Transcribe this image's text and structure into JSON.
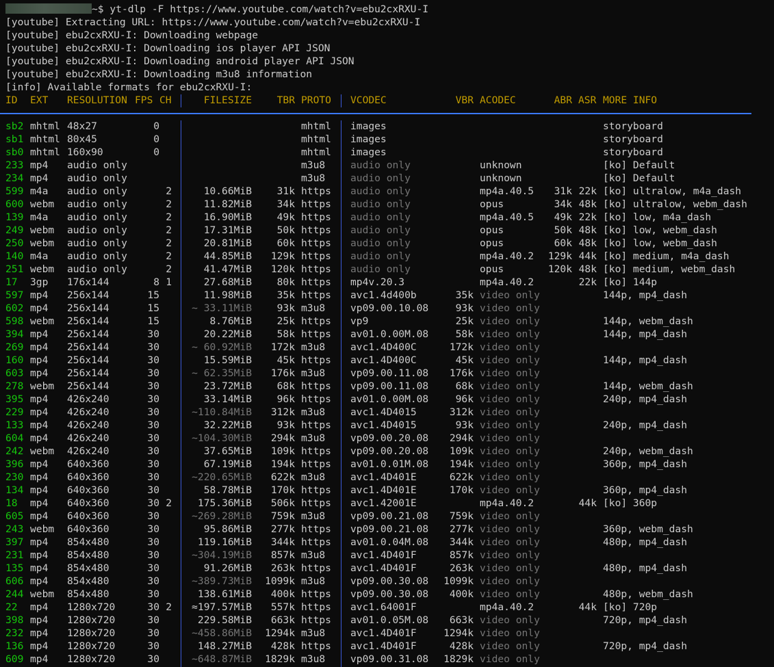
{
  "prompt": {
    "symbol": "~$",
    "command": "yt-dlp -F https://www.youtube.com/watch?v=ebu2cxRXU-I"
  },
  "log": [
    "[youtube] Extracting URL: https://www.youtube.com/watch?v=ebu2cxRXU-I",
    "[youtube] ebu2cxRXU-I: Downloading webpage",
    "[youtube] ebu2cxRXU-I: Downloading ios player API JSON",
    "[youtube] ebu2cxRXU-I: Downloading android player API JSON",
    "[youtube] ebu2cxRXU-I: Downloading m3u8 information",
    "[info] Available formats for ebu2cxRXU-I:"
  ],
  "headers": {
    "id": "ID",
    "ext": "EXT",
    "res": "RESOLUTION",
    "fps": "FPS",
    "ch": "CH",
    "size": "FILESIZE",
    "tbr": "TBR",
    "proto": "PROTO",
    "vcodec": "VCODEC",
    "vbr": "VBR",
    "acodec": "ACODEC",
    "abr": "ABR",
    "asr": "ASR",
    "info": "MORE INFO"
  },
  "colors": {
    "background": "#0c0c0c",
    "text": "#cccccc",
    "header": "#c19c00",
    "id": "#16c60c",
    "dim": "#767676",
    "separator": "#3b5bdb"
  },
  "rows": [
    [
      "sb2",
      "mhtml",
      "48x27",
      "0",
      "",
      "",
      "",
      "mhtml",
      "images",
      "",
      "",
      "",
      "",
      "storyboard"
    ],
    [
      "sb1",
      "mhtml",
      "80x45",
      "0",
      "",
      "",
      "",
      "mhtml",
      "images",
      "",
      "",
      "",
      "",
      "storyboard"
    ],
    [
      "sb0",
      "mhtml",
      "160x90",
      "0",
      "",
      "",
      "",
      "mhtml",
      "images",
      "",
      "",
      "",
      "",
      "storyboard"
    ],
    [
      "233",
      "mp4",
      "audio only",
      "",
      "",
      "",
      "",
      "m3u8",
      "audio only",
      "",
      "unknown",
      "",
      "",
      "[ko] Default"
    ],
    [
      "234",
      "mp4",
      "audio only",
      "",
      "",
      "",
      "",
      "m3u8",
      "audio only",
      "",
      "unknown",
      "",
      "",
      "[ko] Default"
    ],
    [
      "599",
      "m4a",
      "audio only",
      "",
      "2",
      "10.66MiB",
      "31k",
      "https",
      "audio only",
      "",
      "mp4a.40.5",
      "31k",
      "22k",
      "[ko] ultralow, m4a_dash"
    ],
    [
      "600",
      "webm",
      "audio only",
      "",
      "2",
      "11.82MiB",
      "34k",
      "https",
      "audio only",
      "",
      "opus",
      "34k",
      "48k",
      "[ko] ultralow, webm_dash"
    ],
    [
      "139",
      "m4a",
      "audio only",
      "",
      "2",
      "16.90MiB",
      "49k",
      "https",
      "audio only",
      "",
      "mp4a.40.5",
      "49k",
      "22k",
      "[ko] low, m4a_dash"
    ],
    [
      "249",
      "webm",
      "audio only",
      "",
      "2",
      "17.31MiB",
      "50k",
      "https",
      "audio only",
      "",
      "opus",
      "50k",
      "48k",
      "[ko] low, webm_dash"
    ],
    [
      "250",
      "webm",
      "audio only",
      "",
      "2",
      "20.81MiB",
      "60k",
      "https",
      "audio only",
      "",
      "opus",
      "60k",
      "48k",
      "[ko] low, webm_dash"
    ],
    [
      "140",
      "m4a",
      "audio only",
      "",
      "2",
      "44.85MiB",
      "129k",
      "https",
      "audio only",
      "",
      "mp4a.40.2",
      "129k",
      "44k",
      "[ko] medium, m4a_dash"
    ],
    [
      "251",
      "webm",
      "audio only",
      "",
      "2",
      "41.47MiB",
      "120k",
      "https",
      "audio only",
      "",
      "opus",
      "120k",
      "48k",
      "[ko] medium, webm_dash"
    ],
    [
      "17",
      "3gp",
      "176x144",
      "8",
      "1",
      "27.68MiB",
      "80k",
      "https",
      "mp4v.20.3",
      "",
      "mp4a.40.2",
      "",
      "22k",
      "[ko] 144p"
    ],
    [
      "597",
      "mp4",
      "256x144",
      "15",
      "",
      "11.98MiB",
      "35k",
      "https",
      "avc1.4d400b",
      "35k",
      "video only",
      "",
      "",
      "144p, mp4_dash"
    ],
    [
      "602",
      "mp4",
      "256x144",
      "15",
      "",
      "~ 33.11MiB",
      "93k",
      "m3u8",
      "vp09.00.10.08",
      "93k",
      "video only",
      "",
      "",
      ""
    ],
    [
      "598",
      "webm",
      "256x144",
      "15",
      "",
      "8.76MiB",
      "25k",
      "https",
      "vp9",
      "25k",
      "video only",
      "",
      "",
      "144p, webm_dash"
    ],
    [
      "394",
      "mp4",
      "256x144",
      "30",
      "",
      "20.22MiB",
      "58k",
      "https",
      "av01.0.00M.08",
      "58k",
      "video only",
      "",
      "",
      "144p, mp4_dash"
    ],
    [
      "269",
      "mp4",
      "256x144",
      "30",
      "",
      "~ 60.92MiB",
      "172k",
      "m3u8",
      "avc1.4D400C",
      "172k",
      "video only",
      "",
      "",
      ""
    ],
    [
      "160",
      "mp4",
      "256x144",
      "30",
      "",
      "15.59MiB",
      "45k",
      "https",
      "avc1.4D400C",
      "45k",
      "video only",
      "",
      "",
      "144p, mp4_dash"
    ],
    [
      "603",
      "mp4",
      "256x144",
      "30",
      "",
      "~ 62.35MiB",
      "176k",
      "m3u8",
      "vp09.00.11.08",
      "176k",
      "video only",
      "",
      "",
      ""
    ],
    [
      "278",
      "webm",
      "256x144",
      "30",
      "",
      "23.72MiB",
      "68k",
      "https",
      "vp09.00.11.08",
      "68k",
      "video only",
      "",
      "",
      "144p, webm_dash"
    ],
    [
      "395",
      "mp4",
      "426x240",
      "30",
      "",
      "33.14MiB",
      "96k",
      "https",
      "av01.0.00M.08",
      "96k",
      "video only",
      "",
      "",
      "240p, mp4_dash"
    ],
    [
      "229",
      "mp4",
      "426x240",
      "30",
      "",
      "~110.84MiB",
      "312k",
      "m3u8",
      "avc1.4D4015",
      "312k",
      "video only",
      "",
      "",
      ""
    ],
    [
      "133",
      "mp4",
      "426x240",
      "30",
      "",
      "32.22MiB",
      "93k",
      "https",
      "avc1.4D4015",
      "93k",
      "video only",
      "",
      "",
      "240p, mp4_dash"
    ],
    [
      "604",
      "mp4",
      "426x240",
      "30",
      "",
      "~104.30MiB",
      "294k",
      "m3u8",
      "vp09.00.20.08",
      "294k",
      "video only",
      "",
      "",
      ""
    ],
    [
      "242",
      "webm",
      "426x240",
      "30",
      "",
      "37.65MiB",
      "109k",
      "https",
      "vp09.00.20.08",
      "109k",
      "video only",
      "",
      "",
      "240p, webm_dash"
    ],
    [
      "396",
      "mp4",
      "640x360",
      "30",
      "",
      "67.19MiB",
      "194k",
      "https",
      "av01.0.01M.08",
      "194k",
      "video only",
      "",
      "",
      "360p, mp4_dash"
    ],
    [
      "230",
      "mp4",
      "640x360",
      "30",
      "",
      "~220.65MiB",
      "622k",
      "m3u8",
      "avc1.4D401E",
      "622k",
      "video only",
      "",
      "",
      ""
    ],
    [
      "134",
      "mp4",
      "640x360",
      "30",
      "",
      "58.78MiB",
      "170k",
      "https",
      "avc1.4D401E",
      "170k",
      "video only",
      "",
      "",
      "360p, mp4_dash"
    ],
    [
      "18",
      "mp4",
      "640x360",
      "30",
      "2",
      "175.36MiB",
      "506k",
      "https",
      "avc1.42001E",
      "",
      "mp4a.40.2",
      "",
      "44k",
      "[ko] 360p"
    ],
    [
      "605",
      "mp4",
      "640x360",
      "30",
      "",
      "~269.28MiB",
      "759k",
      "m3u8",
      "vp09.00.21.08",
      "759k",
      "video only",
      "",
      "",
      ""
    ],
    [
      "243",
      "webm",
      "640x360",
      "30",
      "",
      "95.86MiB",
      "277k",
      "https",
      "vp09.00.21.08",
      "277k",
      "video only",
      "",
      "",
      "360p, webm_dash"
    ],
    [
      "397",
      "mp4",
      "854x480",
      "30",
      "",
      "119.16MiB",
      "344k",
      "https",
      "av01.0.04M.08",
      "344k",
      "video only",
      "",
      "",
      "480p, mp4_dash"
    ],
    [
      "231",
      "mp4",
      "854x480",
      "30",
      "",
      "~304.19MiB",
      "857k",
      "m3u8",
      "avc1.4D401F",
      "857k",
      "video only",
      "",
      "",
      ""
    ],
    [
      "135",
      "mp4",
      "854x480",
      "30",
      "",
      "91.26MiB",
      "263k",
      "https",
      "avc1.4D401F",
      "263k",
      "video only",
      "",
      "",
      "480p, mp4_dash"
    ],
    [
      "606",
      "mp4",
      "854x480",
      "30",
      "",
      "~389.73MiB",
      "1099k",
      "m3u8",
      "vp09.00.30.08",
      "1099k",
      "video only",
      "",
      "",
      ""
    ],
    [
      "244",
      "webm",
      "854x480",
      "30",
      "",
      "138.61MiB",
      "400k",
      "https",
      "vp09.00.30.08",
      "400k",
      "video only",
      "",
      "",
      "480p, webm_dash"
    ],
    [
      "22",
      "mp4",
      "1280x720",
      "30",
      "2",
      "≈197.57MiB",
      "557k",
      "https",
      "avc1.64001F",
      "",
      "mp4a.40.2",
      "",
      "44k",
      "[ko] 720p"
    ],
    [
      "398",
      "mp4",
      "1280x720",
      "30",
      "",
      "229.58MiB",
      "663k",
      "https",
      "av01.0.05M.08",
      "663k",
      "video only",
      "",
      "",
      "720p, mp4_dash"
    ],
    [
      "232",
      "mp4",
      "1280x720",
      "30",
      "",
      "~458.86MiB",
      "1294k",
      "m3u8",
      "avc1.4D401F",
      "1294k",
      "video only",
      "",
      "",
      ""
    ],
    [
      "136",
      "mp4",
      "1280x720",
      "30",
      "",
      "148.27MiB",
      "428k",
      "https",
      "avc1.4D401F",
      "428k",
      "video only",
      "",
      "",
      "720p, mp4_dash"
    ],
    [
      "609",
      "mp4",
      "1280x720",
      "30",
      "",
      "~648.87MiB",
      "1829k",
      "m3u8",
      "vp09.00.31.08",
      "1829k",
      "video only",
      "",
      "",
      ""
    ]
  ]
}
